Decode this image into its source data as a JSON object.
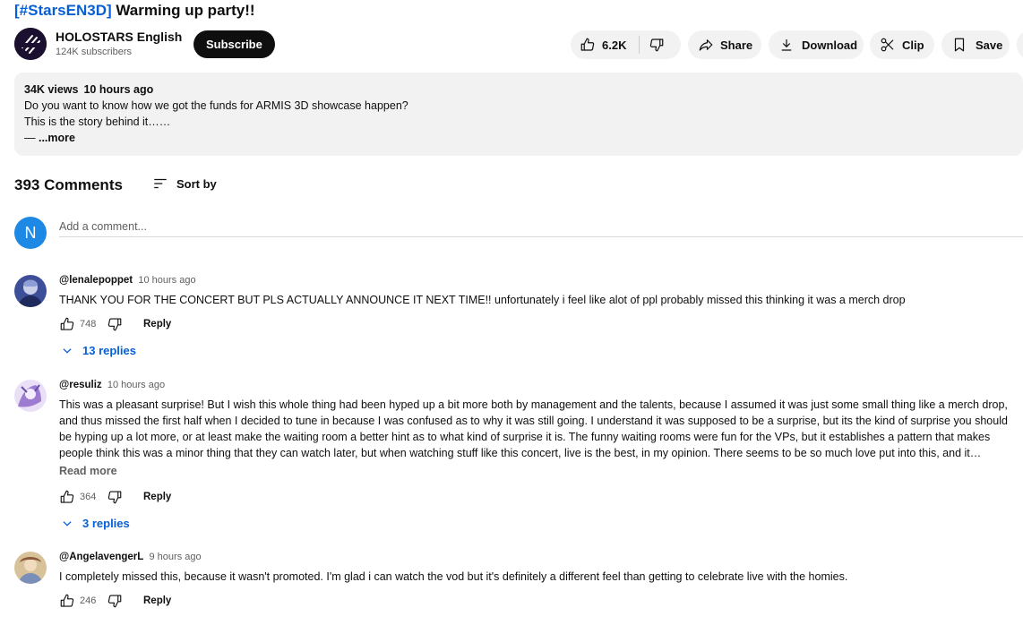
{
  "video": {
    "title_tag": "[#StarsEN3D]",
    "title_rest": " Warming up party!!"
  },
  "channel": {
    "name": "HOLOSTARS English",
    "subscribers": "124K subscribers",
    "subscribe_label": "Subscribe",
    "logo_text": "HOLOSTARS"
  },
  "actions": {
    "like_count": "6.2K",
    "share_label": "Share",
    "download_label": "Download",
    "clip_label": "Clip",
    "save_label": "Save"
  },
  "description": {
    "views": "34K views",
    "posted": "10 hours ago",
    "line1": "Do you want to know how we got the funds for ARMIS 3D showcase happen?",
    "line2": "This is the story behind it……",
    "line3_prefix": "—",
    "more_label": "...more"
  },
  "comments_section": {
    "count_label": "393 Comments",
    "sort_label": "Sort by",
    "user_initial": "N",
    "add_placeholder": "Add a comment..."
  },
  "comments": [
    {
      "author": "@lenalepoppet",
      "time": "10 hours ago",
      "text": "THANK YOU FOR THE CONCERT BUT PLS ACTUALLY ANNOUNCE IT NEXT TIME!! unfortunately i feel like alot of ppl probably missed this thinking it was a merch drop",
      "likes": "748",
      "reply_label": "Reply",
      "replies_label": "13 replies",
      "avatar_color": "#4a5fa8"
    },
    {
      "author": "@resuliz",
      "time": "10 hours ago",
      "text": "This was a pleasant surprise! But I wish this whole thing had been hyped up a bit more both by management and the talents, because I assumed it was just some small thing like a merch drop, and thus missed the first half when I decided to tune in because I was confused as to why it was still going. I understand it was supposed to be a surprise, but its the kind of surprise you should be hyping up a lot more, or at least make the waiting room a better hint as to what kind of surprise it is. The funny waiting rooms were fun for the VPs, but it establishes a pattern that makes people think this was a minor thing that they can watch later, but when watching stuff like this concert, live is the best, in my opinion. There seems to be so much love put into this, and it deserved to be seen live by as many people as possible.",
      "read_more_label": "Read more",
      "likes": "364",
      "reply_label": "Reply",
      "replies_label": "3 replies",
      "avatar_color": "#a98bd6"
    },
    {
      "author": "@AngelavengerL",
      "time": "9 hours ago",
      "text": "I completely missed this, because it wasn't promoted. I'm glad i can watch the vod but it's definitely a different feel than getting to celebrate live with the homies.",
      "likes": "246",
      "reply_label": "Reply",
      "avatar_color": "#c9a46b"
    }
  ]
}
